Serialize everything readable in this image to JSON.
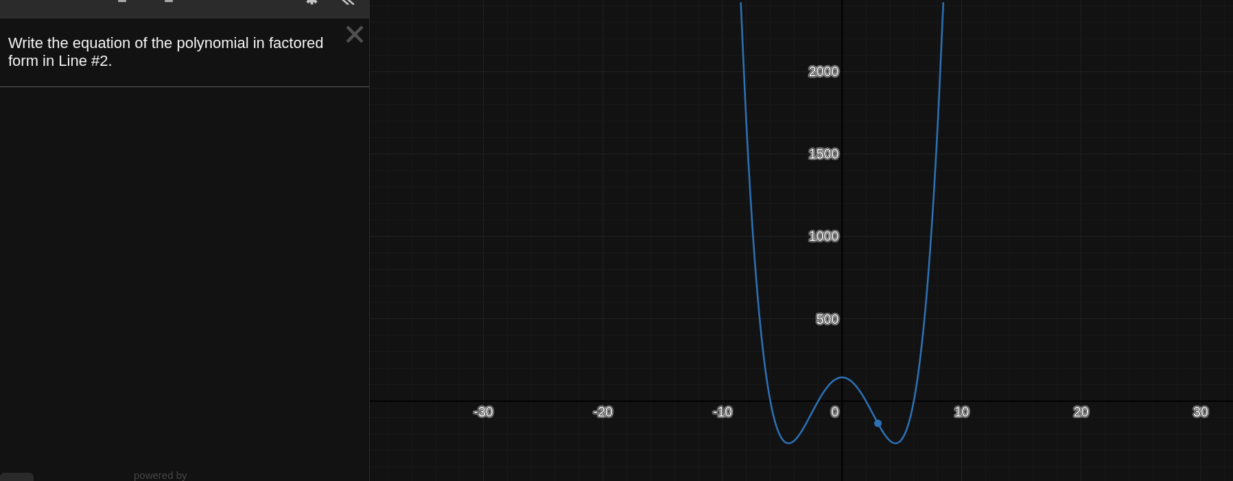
{
  "question": {
    "text": "Write the equation of the polynomial in factored form in Line #2."
  },
  "footer": {
    "text": "powered by"
  },
  "graph": {
    "origin_label": "0",
    "chart_data": {
      "type": "line",
      "grid": true,
      "x": [
        -8.47,
        -8,
        -7.5,
        -7,
        -6.5,
        -6,
        -5.5,
        -5,
        -4.5,
        -4,
        -3.5,
        -3,
        -2.5,
        -2,
        -1.5,
        -1,
        -0.5,
        0,
        0.5,
        1,
        1.5,
        2,
        2.5,
        3,
        3.5,
        4,
        4.5,
        5,
        5.5,
        6,
        6.5,
        7,
        7.5,
        8,
        8.47
      ],
      "series": [
        {
          "color": "#2d70b3",
          "values": [
            2421,
            1680,
            1058,
            585,
            239,
            0,
            -151,
            -231,
            -256,
            -240,
            -196,
            -135,
            -67,
            0,
            59,
            105,
            134,
            144,
            134,
            105,
            59,
            0,
            -67,
            -135,
            -196,
            -240,
            -256,
            -231,
            -151,
            0,
            239,
            585,
            1058,
            1680,
            2421
          ]
        },
        {
          "color": "#2d70b3",
          "marker": "circle",
          "values": [
            null,
            null,
            null,
            null,
            null,
            null,
            null,
            null,
            null,
            null,
            null,
            null,
            null,
            null,
            null,
            null,
            null,
            null,
            null,
            null,
            null,
            null,
            null,
            -135,
            null,
            null,
            null,
            null,
            null,
            null,
            null,
            null,
            null,
            null,
            null
          ]
        }
      ],
      "xlim": [
        -39.5,
        32.7
      ],
      "ylim": [
        -485,
        2435
      ],
      "xticks": [
        -30,
        -20,
        -10,
        10,
        20,
        30
      ],
      "yticks": [
        500,
        1000,
        1500,
        2000
      ]
    }
  }
}
